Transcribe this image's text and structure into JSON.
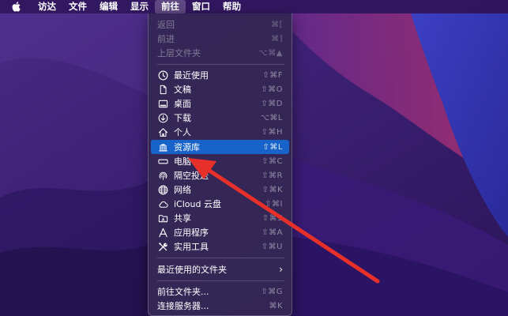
{
  "menubar": {
    "items": [
      "访达",
      "文件",
      "编辑",
      "显示",
      "前往",
      "窗口",
      "帮助"
    ],
    "active": "前往"
  },
  "go_menu": {
    "history": [
      {
        "label": "返回",
        "shortcut": "⌘[",
        "enabled": false
      },
      {
        "label": "前进",
        "shortcut": "⌘]",
        "enabled": false
      },
      {
        "label": "上层文件夹",
        "shortcut": "⌥⌘▲",
        "enabled": false
      }
    ],
    "places": [
      {
        "label": "最近使用",
        "shortcut": "⇧⌘F",
        "icon": "clock-icon"
      },
      {
        "label": "文稿",
        "shortcut": "⇧⌘O",
        "icon": "document-icon"
      },
      {
        "label": "桌面",
        "shortcut": "⇧⌘D",
        "icon": "desktop-icon"
      },
      {
        "label": "下载",
        "shortcut": "⌥⌘L",
        "icon": "download-icon"
      },
      {
        "label": "个人",
        "shortcut": "⇧⌘H",
        "icon": "home-icon"
      },
      {
        "label": "资源库",
        "shortcut": "⇧⌘L",
        "icon": "library-icon",
        "highlighted": true
      },
      {
        "label": "电脑",
        "shortcut": "⇧⌘C",
        "icon": "computer-icon"
      },
      {
        "label": "隔空投送",
        "shortcut": "⇧⌘R",
        "icon": "airdrop-icon"
      },
      {
        "label": "网络",
        "shortcut": "⇧⌘K",
        "icon": "network-icon"
      },
      {
        "label": "iCloud 云盘",
        "shortcut": "⇧⌘I",
        "icon": "cloud-icon"
      },
      {
        "label": "共享",
        "shortcut": "⇧⌘S",
        "icon": "shared-folder-icon"
      },
      {
        "label": "应用程序",
        "shortcut": "⇧⌘A",
        "icon": "applications-icon"
      },
      {
        "label": "实用工具",
        "shortcut": "⇧⌘U",
        "icon": "utilities-icon"
      }
    ],
    "recent_folders": {
      "label": "最近使用的文件夹"
    },
    "folder_actions": [
      {
        "label": "前往文件夹...",
        "shortcut": "⇧⌘G"
      },
      {
        "label": "连接服务器...",
        "shortcut": "⌘K"
      }
    ]
  },
  "colors": {
    "highlight": "#1763c9",
    "annotation_arrow": "#e8302a"
  }
}
